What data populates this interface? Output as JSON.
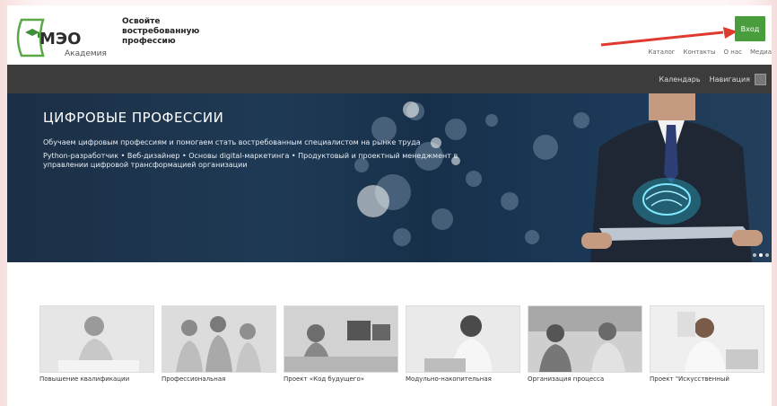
{
  "header": {
    "logo_brand": "МЭО",
    "logo_sub": "Академия",
    "slogan": "Освойте востребованную профессию",
    "login_label": "Вход",
    "nav": [
      "Каталог",
      "Контакты",
      "О нас",
      "Медиа"
    ]
  },
  "subnav": {
    "items": [
      "Календарь",
      "Навигация"
    ]
  },
  "banner": {
    "title": "ЦИФРОВЫЕ ПРОФЕССИИ",
    "subtitle": "Обучаем цифровым профессиям и помогаем стать востребованным специалистом на рынке труда",
    "list": "Python-разработчик • Веб-дизайнер • Основы digital-маркетинга • Продуктовый и проектный менеджмент в управлении цифровой трансформацией организации"
  },
  "cards": [
    {
      "title": "Повышение квалификации"
    },
    {
      "title": "Профессиональная"
    },
    {
      "title": "Проект «Код будущего»"
    },
    {
      "title": "Модульно-накопительная"
    },
    {
      "title": "Организация процесса"
    },
    {
      "title": "Проект \"Искусственный"
    }
  ],
  "colors": {
    "accent_green": "#4a9d3d",
    "arrow_red": "#e03a2f",
    "dark_bar": "#3c3c3c"
  }
}
